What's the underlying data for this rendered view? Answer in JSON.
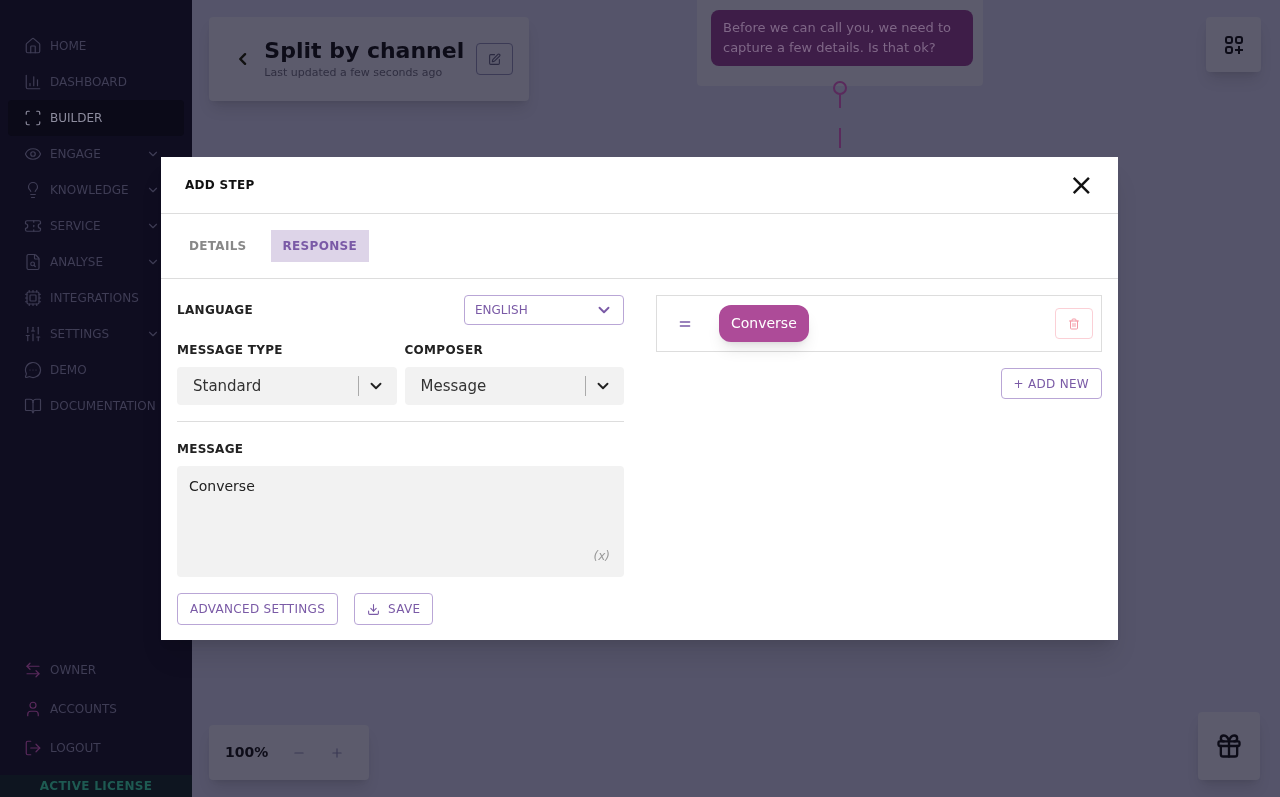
{
  "sidebar": {
    "items": [
      {
        "label": "HOME",
        "kind": "link",
        "selected": false
      },
      {
        "label": "DASHBOARD",
        "kind": "link",
        "selected": false
      },
      {
        "label": "BUILDER",
        "kind": "link",
        "selected": true
      },
      {
        "label": "ENGAGE",
        "kind": "group",
        "selected": false
      },
      {
        "label": "KNOWLEDGE",
        "kind": "group",
        "selected": false
      },
      {
        "label": "SERVICE",
        "kind": "group",
        "selected": false
      },
      {
        "label": "ANALYSE",
        "kind": "group",
        "selected": false
      },
      {
        "label": "INTEGRATIONS",
        "kind": "link",
        "selected": false
      },
      {
        "label": "SETTINGS",
        "kind": "group",
        "selected": false
      },
      {
        "label": "DEMO",
        "kind": "link",
        "selected": false
      },
      {
        "label": "DOCUMENTATION",
        "kind": "link",
        "selected": false
      }
    ],
    "bottom_items": [
      {
        "label": "OWNER"
      },
      {
        "label": "ACCOUNTS"
      },
      {
        "label": "LOGOUT"
      }
    ],
    "license": "ACTIVE LICENSE"
  },
  "flow_header": {
    "title": "Split by channel",
    "subtitle": "Last updated a few seconds ago"
  },
  "canvas_node": {
    "text": "Before we can call you, we need to capture a few details. Is that ok?"
  },
  "zoom": {
    "value": "100%"
  },
  "dialog": {
    "title": "ADD STEP",
    "close": "×",
    "tabs": [
      {
        "label": "DETAILS",
        "selected": false
      },
      {
        "label": "RESPONSE",
        "selected": true
      }
    ],
    "language": {
      "label": "LANGUAGE",
      "value": "ENGLISH"
    },
    "message_type": {
      "label": "MESSAGE TYPE",
      "value": "Standard"
    },
    "composer": {
      "label": "COMPOSER",
      "value": "Message"
    },
    "message": {
      "label": "MESSAGE",
      "value": "Converse",
      "variable": "(x)"
    },
    "buttons": [
      {
        "label": "ADVANCED SETTINGS",
        "kind": "plain"
      },
      {
        "label": "SAVE",
        "kind": "save"
      }
    ],
    "responses": [
      {
        "label": "Converse"
      }
    ],
    "add_new": "+ ADD NEW"
  }
}
